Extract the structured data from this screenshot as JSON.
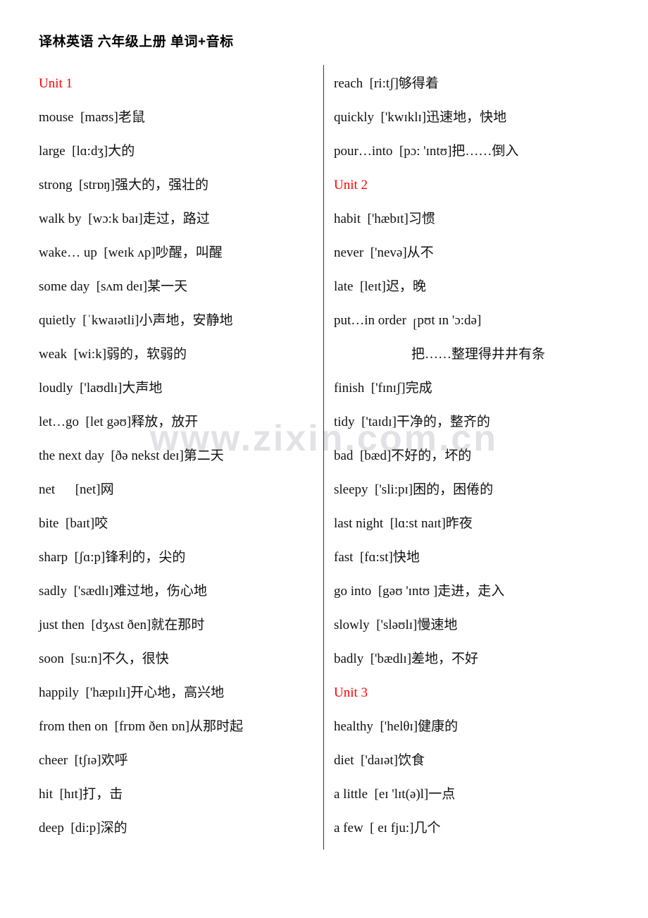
{
  "document": {
    "title": "译林英语  六年级上册  单词+音标",
    "watermark": "www.zixin.com.cn",
    "unit_color": "#ff0000",
    "text_color": "#111111"
  },
  "columns": {
    "left": [
      {
        "kind": "unit",
        "text": "Unit  1"
      },
      {
        "kind": "entry",
        "word": "mouse",
        "phonetic": "[maʊs]",
        "cn": "老鼠"
      },
      {
        "kind": "entry",
        "word": "large",
        "phonetic": "[lɑ:dʒ]",
        "cn": "大的"
      },
      {
        "kind": "entry",
        "word": "strong",
        "phonetic": "[strɒŋ]",
        "cn": "强大的，强壮的"
      },
      {
        "kind": "entry",
        "word": "walk  by",
        "phonetic": "[wɔ:k baɪ]",
        "cn": "走过，路过"
      },
      {
        "kind": "entry",
        "word": "wake…  up",
        "phonetic": "[weɪk ʌp]",
        "cn": "吵醒，叫醒"
      },
      {
        "kind": "entry",
        "word": "some  day",
        "phonetic": "[sʌm deɪ]",
        "cn": "某一天"
      },
      {
        "kind": "entry",
        "word": "quietly",
        "phonetic": "[ˈkwaɪətli]",
        "cn": "小声地，安静地"
      },
      {
        "kind": "entry",
        "word": "weak",
        "phonetic": "[wi:k]",
        "cn": "弱的，软弱的"
      },
      {
        "kind": "entry",
        "word": "loudly",
        "phonetic": "['laʊdlɪ]",
        "cn": "大声地"
      },
      {
        "kind": "entry",
        "word": "let…go",
        "phonetic": "[let gəʊ]",
        "cn": "释放，放开"
      },
      {
        "kind": "entry",
        "word": "the  next  day",
        "phonetic": "[ðə nekst deɪ]",
        "cn": "第二天"
      },
      {
        "kind": "entry",
        "word": "net",
        "phonetic": "[net]",
        "cn": "网",
        "gap": "wide"
      },
      {
        "kind": "entry",
        "word": "bite",
        "phonetic": "[baɪt]",
        "cn": "咬"
      },
      {
        "kind": "entry",
        "word": "sharp",
        "phonetic": "[ʃɑ:p]",
        "cn": "锋利的，尖的"
      },
      {
        "kind": "entry",
        "word": "sadly",
        "phonetic": "['sædlɪ]",
        "cn": "难过地，伤心地"
      },
      {
        "kind": "entry",
        "word": "just  then",
        "phonetic": "[dʒʌst ðen]",
        "cn": "就在那时"
      },
      {
        "kind": "entry",
        "word": "soon",
        "phonetic": "[su:n]",
        "cn": "不久，很快"
      },
      {
        "kind": "entry",
        "word": "happily",
        "phonetic": "['hæpɪlɪ]",
        "cn": "开心地，高兴地"
      },
      {
        "kind": "entry",
        "word": "from  then  on",
        "phonetic": "[frɒm ðen ɒn]",
        "cn": "从那时起"
      },
      {
        "kind": "entry",
        "word": "cheer",
        "phonetic": "[tʃɪə]",
        "cn": "欢呼"
      },
      {
        "kind": "entry",
        "word": "hit",
        "phonetic": "[hɪt]",
        "cn": "打，击"
      },
      {
        "kind": "entry",
        "word": "deep",
        "phonetic": "[di:p]",
        "cn": "深的"
      }
    ],
    "right": [
      {
        "kind": "entry",
        "word": "reach",
        "phonetic": "[ri:tʃ]",
        "cn": "够得着"
      },
      {
        "kind": "entry",
        "word": "quickly",
        "phonetic": "['kwɪklɪ]",
        "cn": "迅速地，快地"
      },
      {
        "kind": "entry",
        "word": "pour…into",
        "phonetic": "[pɔ: 'ɪntʊ]",
        "cn": "把……倒入"
      },
      {
        "kind": "unit",
        "text": "Unit  2"
      },
      {
        "kind": "entry",
        "word": "habit",
        "phonetic": "['hæbɪt]",
        "cn": "习惯"
      },
      {
        "kind": "entry",
        "word": "never",
        "phonetic": "['nevə]",
        "cn": "从不"
      },
      {
        "kind": "entry",
        "word": "late",
        "phonetic": "[leɪt]",
        "cn": "迟，晚"
      },
      {
        "kind": "entry",
        "word": "put…in  order",
        "phonetic": "[pʊt ɪn 'ɔ:də]",
        "cn": "",
        "bracket_style": "subscript"
      },
      {
        "kind": "cont",
        "text": "把……整理得井井有条"
      },
      {
        "kind": "entry",
        "word": "finish",
        "phonetic": "['fɪnɪʃ]",
        "cn": "完成"
      },
      {
        "kind": "entry",
        "word": "tidy",
        "phonetic": "['taɪdɪ]",
        "cn": "干净的，整齐的"
      },
      {
        "kind": "entry",
        "word": "bad",
        "phonetic": "[bæd]",
        "cn": "不好的，坏的"
      },
      {
        "kind": "entry",
        "word": "sleepy",
        "phonetic": "['sli:pɪ]",
        "cn": "困的，困倦的"
      },
      {
        "kind": "entry",
        "word": "last  night",
        "phonetic": "[lɑ:st naɪt]",
        "cn": "昨夜"
      },
      {
        "kind": "entry",
        "word": "fast",
        "phonetic": "[fɑ:st]",
        "cn": "快地"
      },
      {
        "kind": "entry",
        "word": "go  into",
        "phonetic": "[gəʊ  'ɪntʊ ]",
        "cn": "走进，走入"
      },
      {
        "kind": "entry",
        "word": "slowly",
        "phonetic": "['sləʊlɪ]",
        "cn": "慢速地"
      },
      {
        "kind": "entry",
        "word": "badly",
        "phonetic": "['bædlɪ]",
        "cn": "差地，不好"
      },
      {
        "kind": "unit",
        "text": "Unit  3"
      },
      {
        "kind": "entry",
        "word": "healthy",
        "phonetic": "['helθɪ]",
        "cn": "健康的"
      },
      {
        "kind": "entry",
        "word": "diet",
        "phonetic": "['daɪət]",
        "cn": "饮食"
      },
      {
        "kind": "entry",
        "word": "a  little",
        "phonetic": "[eɪ 'lɪt(ə)l]",
        "cn": "一点"
      },
      {
        "kind": "entry",
        "word": "a  few",
        "phonetic": "[ eɪ fju:]",
        "cn": "几个"
      }
    ]
  }
}
